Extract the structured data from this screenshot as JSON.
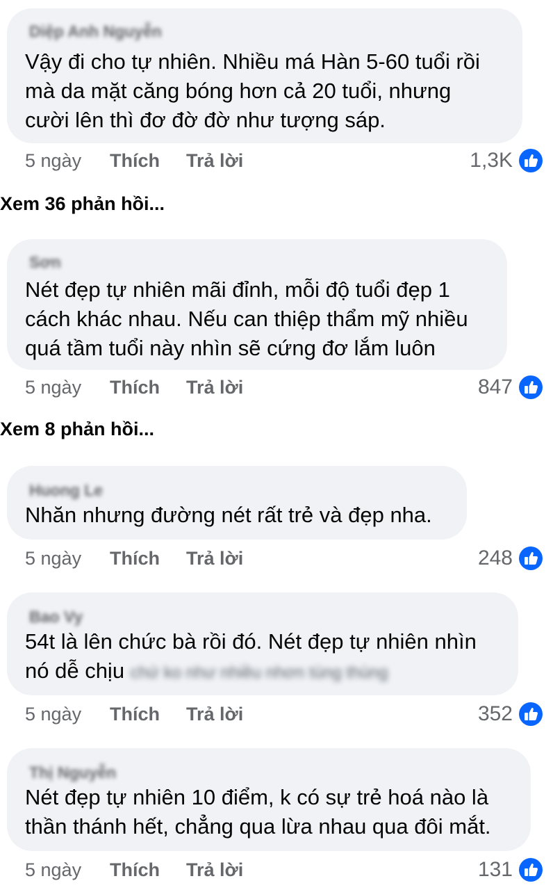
{
  "comments": [
    {
      "name": "Diệp Anh Nguyễn",
      "lines": [
        "Vậy đi cho tự nhiên. Nhiều má Hàn 5-60 tuổi rồi",
        "mà da mặt căng bóng hơn cả 20 tuổi, nhưng",
        "cười lên thì đơ đờ đờ như tượng sáp."
      ],
      "time": "5 ngày",
      "like_label": "Thích",
      "reply_label": "Trả lời",
      "reactions": "1,3K",
      "view_replies": "Xem 36 phản hồi..."
    },
    {
      "name": "Sơn",
      "lines": [
        "Nét đẹp tự nhiên mãi đỉnh, mỗi độ tuổi đẹp 1",
        "cách khác nhau. Nếu can thiệp thẩm mỹ nhiều",
        "quá tầm tuổi này nhìn sẽ cứng đơ lắm luôn"
      ],
      "time": "5 ngày",
      "like_label": "Thích",
      "reply_label": "Trả lời",
      "reactions": "847",
      "view_replies": "Xem 8 phản hồi..."
    },
    {
      "name": "Huong Le",
      "lines": [
        "Nhăn nhưng đường nét rất trẻ và đẹp nha."
      ],
      "time": "5 ngày",
      "like_label": "Thích",
      "reply_label": "Trả lời",
      "reactions": "248"
    },
    {
      "name": "Bao Vy",
      "lines": [
        "54t là lên chức bà rồi đó. Nét đẹp tự nhiên nhìn",
        "nó dễ chịu"
      ],
      "blurred_tail": "chứ ko như nhiều nhơn tùng thùng",
      "time": "5 ngày",
      "like_label": "Thích",
      "reply_label": "Trả lời",
      "reactions": "352"
    },
    {
      "name": "Thị Nguyễn",
      "lines": [
        "Nét đẹp tự nhiên 10 điểm, k có sự trẻ hoá nào là",
        "thần thánh hết, chẳng qua lừa nhau qua đôi mắt."
      ],
      "time": "5 ngày",
      "like_label": "Thích",
      "reply_label": "Trả lời",
      "reactions": "131"
    }
  ],
  "icons": {
    "reaction": "like-thumbs-up-icon"
  },
  "colors": {
    "bubble": "#f0f2f5",
    "meta_text": "#65676b",
    "like_blue": "#0866ff"
  }
}
